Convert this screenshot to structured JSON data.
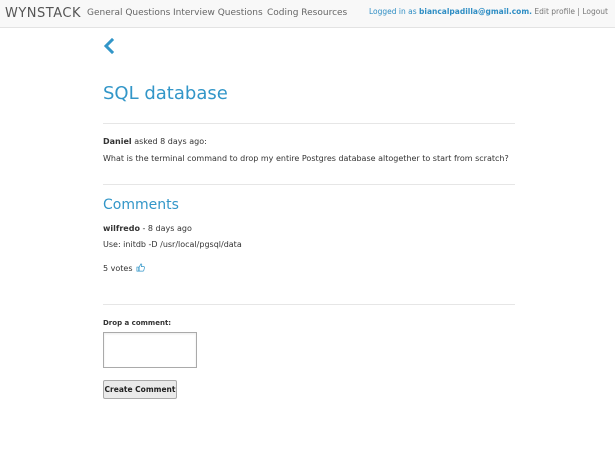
{
  "nav": {
    "brand": "WYNSTACK",
    "links": [
      "General Questions",
      "Interview Questions",
      "Coding Resources"
    ],
    "logged_in_prefix": "Logged in as",
    "user_email": "biancalpadilla@gmail.com.",
    "edit_profile": "Edit profile",
    "separator": "|",
    "logout": "Logout"
  },
  "back_icon": "chevron-left-icon",
  "question": {
    "title": "SQL database",
    "author": "Daniel",
    "asked_suffix": "asked 8 days ago:",
    "body": "What is the terminal command to drop my entire Postgres database altogether to start from scratch?"
  },
  "comments": {
    "heading": "Comments",
    "items": [
      {
        "author": "wilfredo",
        "time": " - 8 days ago",
        "text": "Use: initdb -D /usr/local/pgsql/data",
        "votes": "5 votes",
        "vote_icon": "thumbs-up-icon"
      }
    ]
  },
  "form": {
    "label": "Drop a comment:",
    "textarea_value": "",
    "submit_label": "Create Comment"
  },
  "colors": {
    "accent": "#3296c8",
    "link": "#2f8ec4"
  }
}
